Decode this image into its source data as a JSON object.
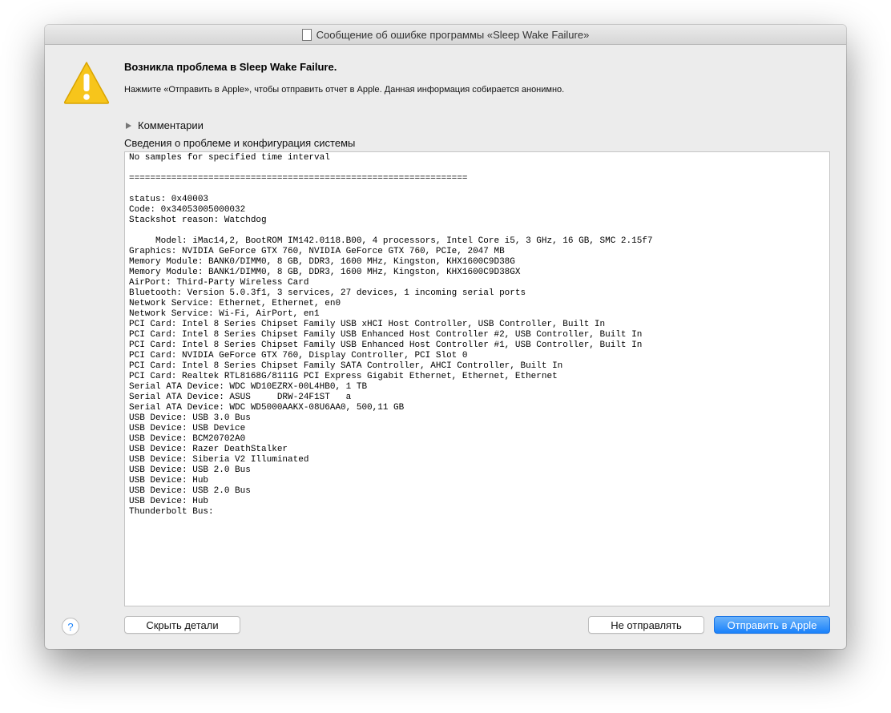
{
  "window": {
    "title": "Сообщение об ошибке программы «Sleep Wake Failure»"
  },
  "header": {
    "title": "Возникла проблема в Sleep Wake Failure.",
    "message": "Нажмите «Отправить в Apple», чтобы отправить отчет в Apple. Данная информация собирается анонимно."
  },
  "comments_label": "Комментарии",
  "details_label": "Сведения о проблеме и конфигурация системы",
  "report_text": "No samples for specified time interval\n\n================================================================\n\nstatus: 0x40003\nCode: 0x34053005000032\nStackshot reason: Watchdog\n\n     Model: iMac14,2, BootROM IM142.0118.B00, 4 processors, Intel Core i5, 3 GHz, 16 GB, SMC 2.15f7\nGraphics: NVIDIA GeForce GTX 760, NVIDIA GeForce GTX 760, PCIe, 2047 MB\nMemory Module: BANK0/DIMM0, 8 GB, DDR3, 1600 MHz, Kingston, KHX1600C9D38G\nMemory Module: BANK1/DIMM0, 8 GB, DDR3, 1600 MHz, Kingston, KHX1600C9D38GX\nAirPort: Third-Party Wireless Card\nBluetooth: Version 5.0.3f1, 3 services, 27 devices, 1 incoming serial ports\nNetwork Service: Ethernet, Ethernet, en0\nNetwork Service: Wi-Fi, AirPort, en1\nPCI Card: Intel 8 Series Chipset Family USB xHCI Host Controller, USB Controller, Built In\nPCI Card: Intel 8 Series Chipset Family USB Enhanced Host Controller #2, USB Controller, Built In\nPCI Card: Intel 8 Series Chipset Family USB Enhanced Host Controller #1, USB Controller, Built In\nPCI Card: NVIDIA GeForce GTX 760, Display Controller, PCI Slot 0\nPCI Card: Intel 8 Series Chipset Family SATA Controller, AHCI Controller, Built In\nPCI Card: Realtek RTL8168G/8111G PCI Express Gigabit Ethernet, Ethernet, Ethernet\nSerial ATA Device: WDC WD10EZRX-00L4HB0, 1 TB\nSerial ATA Device: ASUS     DRW-24F1ST   a\nSerial ATA Device: WDC WD5000AAKX-08U6AA0, 500,11 GB\nUSB Device: USB 3.0 Bus\nUSB Device: USB Device\nUSB Device: BCM20702A0\nUSB Device: Razer DeathStalker\nUSB Device: Siberia V2 Illuminated\nUSB Device: USB 2.0 Bus\nUSB Device: Hub\nUSB Device: USB 2.0 Bus\nUSB Device: Hub\nThunderbolt Bus:",
  "buttons": {
    "help": "?",
    "hide_details": "Скрыть детали",
    "dont_send": "Не отправлять",
    "send": "Отправить в Apple"
  },
  "colors": {
    "accent": "#1a82fb",
    "warning": "#f7c51b"
  }
}
